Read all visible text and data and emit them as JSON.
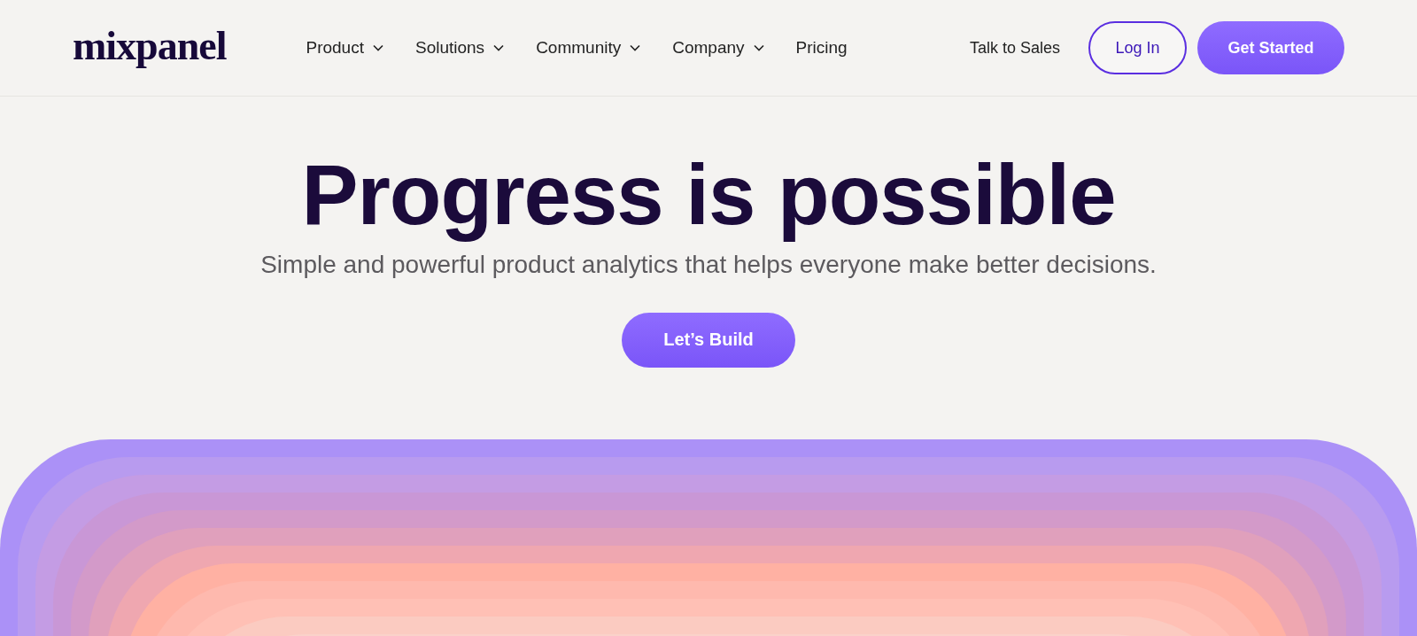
{
  "logo": "mixpanel",
  "nav": [
    {
      "label": "Product",
      "dropdown": true
    },
    {
      "label": "Solutions",
      "dropdown": true
    },
    {
      "label": "Community",
      "dropdown": true
    },
    {
      "label": "Company",
      "dropdown": true
    },
    {
      "label": "Pricing",
      "dropdown": false
    }
  ],
  "actions": [
    {
      "label": "Talk to Sales",
      "kind": "link"
    },
    {
      "label": "Log In",
      "kind": "outline"
    },
    {
      "label": "Get Started",
      "kind": "primary"
    }
  ],
  "hero": {
    "title": "Progress is possible",
    "subtitle": "Simple and powerful product analytics that helps everyone make better decisions.",
    "button": "Let’s Build"
  }
}
